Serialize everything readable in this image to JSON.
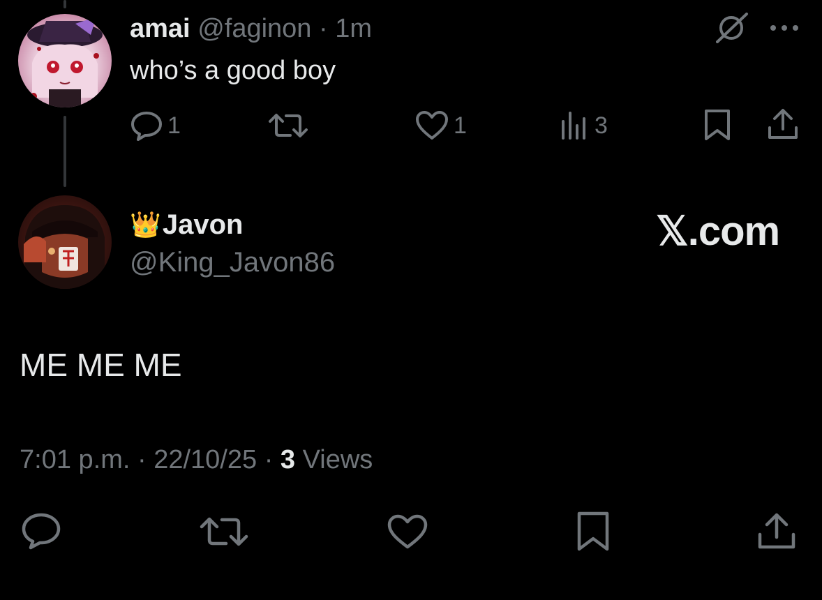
{
  "reply": {
    "display_name": "amai",
    "handle": "@faginon",
    "separator": "·",
    "time": "1m",
    "text": "who’s a good boy",
    "actions": {
      "replies": "1",
      "reposts": "",
      "likes": "1",
      "views": "3"
    }
  },
  "tweet": {
    "emoji": "👑",
    "display_name": "Javon",
    "handle": "@King_Javon86",
    "text": "ME ME ME",
    "time": "7:01 p.m.",
    "date_separator": "·",
    "date": "22/10/25",
    "views_separator": "·",
    "views_count": "3",
    "views_label": "Views"
  },
  "watermark": "𝕏.com",
  "colors": {
    "background": "#000000",
    "text_primary": "#e7e9ea",
    "text_secondary": "#71767b",
    "thread_line": "#333639"
  },
  "icons": [
    "grok-icon",
    "more-icon",
    "reply-icon",
    "repost-icon",
    "like-icon",
    "views-icon",
    "bookmark-icon",
    "share-icon"
  ]
}
